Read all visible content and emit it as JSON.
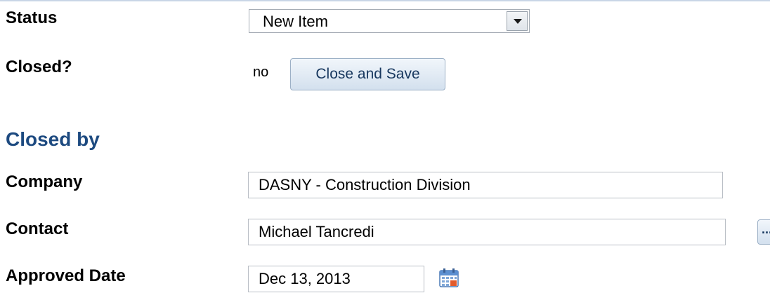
{
  "form": {
    "status": {
      "label": "Status",
      "selected": "New Item"
    },
    "closed": {
      "label": "Closed?",
      "value": "no",
      "button_label": "Close and Save"
    },
    "closed_by_heading": "Closed by",
    "company": {
      "label": "Company",
      "value": "DASNY - Construction Division"
    },
    "contact": {
      "label": "Contact",
      "value": "Michael Tancredi",
      "lookup_button_label": "..."
    },
    "approved_date": {
      "label": "Approved Date",
      "value": "Dec 13, 2013"
    }
  },
  "icons": {
    "dropdown": "chevron-down-icon",
    "calendar": "calendar-icon"
  },
  "colors": {
    "heading": "#1d4a80",
    "button_text": "#17375e",
    "button_border": "#9cb0c6"
  }
}
